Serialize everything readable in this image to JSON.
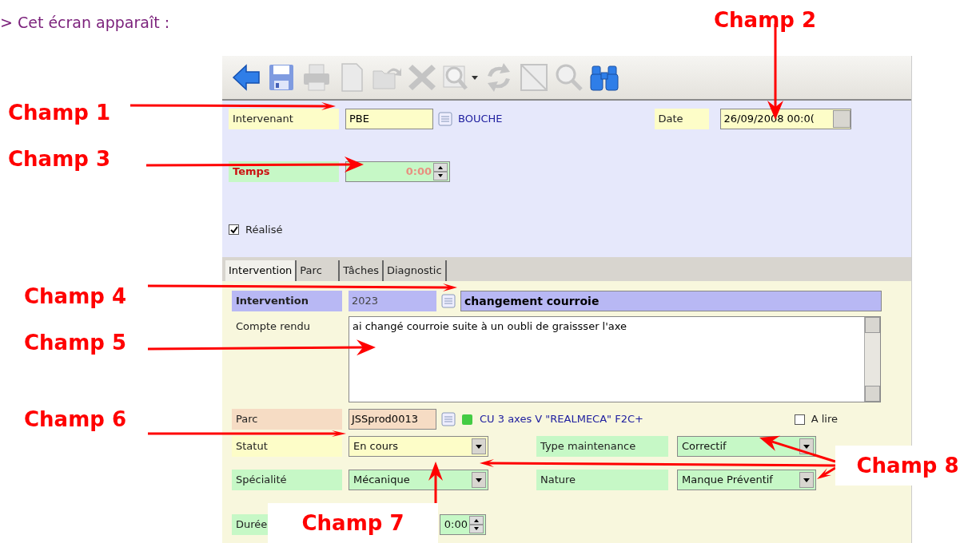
{
  "intro": "> Cet écran apparaît :",
  "toolbar": [
    {
      "kind": "back",
      "disabled": false
    },
    {
      "kind": "save",
      "disabled": false
    },
    {
      "kind": "print",
      "disabled": true
    },
    {
      "kind": "new",
      "disabled": true
    },
    {
      "kind": "open",
      "disabled": true
    },
    {
      "kind": "delete",
      "disabled": true
    },
    {
      "kind": "zoom-menu",
      "disabled": true
    },
    {
      "kind": "refresh",
      "disabled": true
    },
    {
      "kind": "grid",
      "disabled": true
    },
    {
      "kind": "search",
      "disabled": true
    },
    {
      "kind": "find",
      "disabled": false
    }
  ],
  "header": {
    "intervenant": {
      "label": "Intervenant",
      "value": "PBE",
      "name": "BOUCHE"
    },
    "date": {
      "label": "Date",
      "value": "26/09/2008 00:0("
    },
    "temps": {
      "label": "Temps",
      "value": "0:00"
    },
    "realise": {
      "label": "Réalisé",
      "checked": true
    }
  },
  "tabs": [
    {
      "label": "Intervention",
      "selected": true
    },
    {
      "label": "Parc",
      "selected": false
    },
    {
      "label": "Tâches",
      "selected": false
    },
    {
      "label": "Diagnostic",
      "selected": false
    }
  ],
  "form": {
    "intervention": {
      "label": "Intervention",
      "number": "2023",
      "title": "changement courroie"
    },
    "compte_rendu": {
      "label": "Compte rendu",
      "value": "ai changé courroie suite à un oubli de graissser l'axe"
    },
    "parc": {
      "label": "Parc",
      "value": "JSSprod0013",
      "name": "CU 3 axes V \"REALMECA\" F2C+",
      "color": "#44cc44"
    },
    "a_lire": {
      "label": "A lire",
      "checked": false
    },
    "statut": {
      "label": "Statut",
      "value": "En cours"
    },
    "type_maintenance": {
      "label": "Type maintenance",
      "value": "Correctif"
    },
    "specialite": {
      "label": "Spécialité",
      "value": "Mécanique"
    },
    "nature": {
      "label": "Nature",
      "value": "Manque Préventif"
    },
    "duree": {
      "label": "Durée",
      "value": "0:00"
    }
  },
  "annotations": [
    "Champ 1",
    "Champ 2",
    "Champ 3",
    "Champ 4",
    "Champ 5",
    "Champ 6",
    "Champ 7",
    "Champ 8"
  ]
}
